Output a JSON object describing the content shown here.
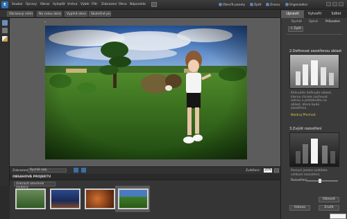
{
  "app": {
    "logo": "E"
  },
  "menu": [
    "Soubor",
    "Úpravy",
    "Obraz",
    "Vylepšit",
    "Vrstva",
    "Výběr",
    "Filtr",
    "Zobrazení",
    "Okno",
    "Nápověda"
  ],
  "top_actions": [
    "Otevřít panely",
    "Zpět",
    "Znovu",
    "Organizátor"
  ],
  "doc_tabs": [
    "Obrazový režim",
    "Na celou obraz.",
    "Vyplnit okno",
    "Skutečné pixely"
  ],
  "zoom": {
    "label": "Zvětšení:",
    "value": "20%"
  },
  "bin": {
    "title": "OBSAHOVÁ PROJEKTU",
    "dropdown": "Zobrazit otevřené soubory"
  },
  "panel": {
    "tabs": [
      "Upravit",
      "Vytvořit",
      "Sdílet"
    ],
    "subtabs": [
      "Rychlé",
      "Úplné",
      "Průvodce"
    ],
    "back_button": "< Zpět",
    "step2_title": "2.Definovat zaostřenou oblast",
    "step2_text": "Kliknutím definujte oblast, kterou chcete zachovat ostrou a přetáhněte na oblast, která bude zaostřena.",
    "step2_link": "Nástroj Přechod",
    "step3_title": "3.Zvýšit rozostření",
    "step3_text": "Pomocí jezdce zvětšete velikost rozostření.",
    "slider_label": "Rozostření",
    "reset_button": "Obnovit",
    "done_button": "Hotovo",
    "cancel_button": "Zrušit"
  },
  "statusbar": {
    "left": "Zobrazení",
    "dropdown": "Rychlé zob."
  }
}
